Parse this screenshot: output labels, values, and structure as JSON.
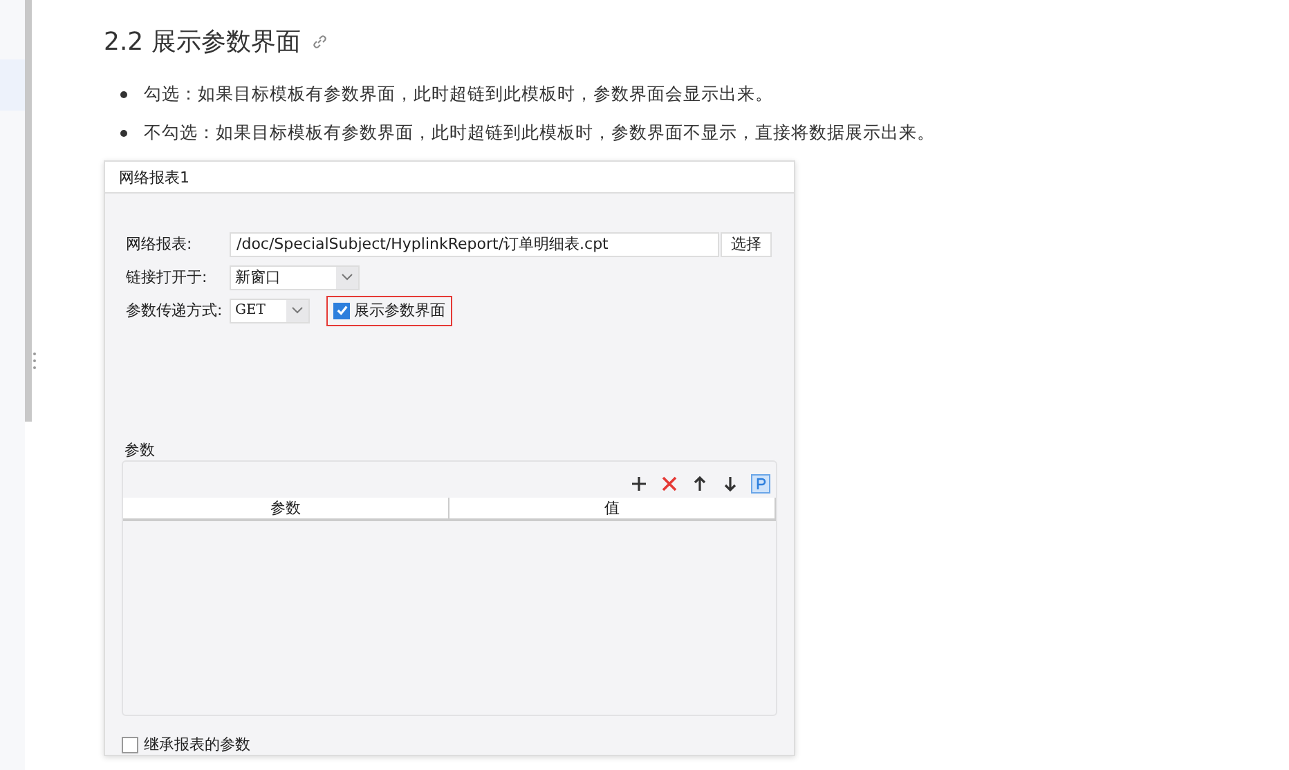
{
  "heading": "2.2 展示参数界面",
  "bullets": [
    "勾选：如果目标模板有参数界面，此时超链到此模板时，参数界面会显示出来。",
    "不勾选：如果目标模板有参数界面，此时超链到此模板时，参数界面不显示，直接将数据展示出来。"
  ],
  "dialog": {
    "title": "网络报表1",
    "report": {
      "label": "网络报表:",
      "value": "/doc/SpecialSubject/HyplinkReport/订单明细表.cpt",
      "button": "选择"
    },
    "open_in": {
      "label": "链接打开于:",
      "value": "新窗口"
    },
    "method": {
      "label": "参数传递方式:",
      "value": "GET"
    },
    "show_params": {
      "label": "展示参数界面",
      "checked": true
    },
    "params": {
      "title": "参数",
      "columns": [
        "参数",
        "值"
      ]
    },
    "inherit": {
      "label": "继承报表的参数",
      "checked": false
    }
  }
}
